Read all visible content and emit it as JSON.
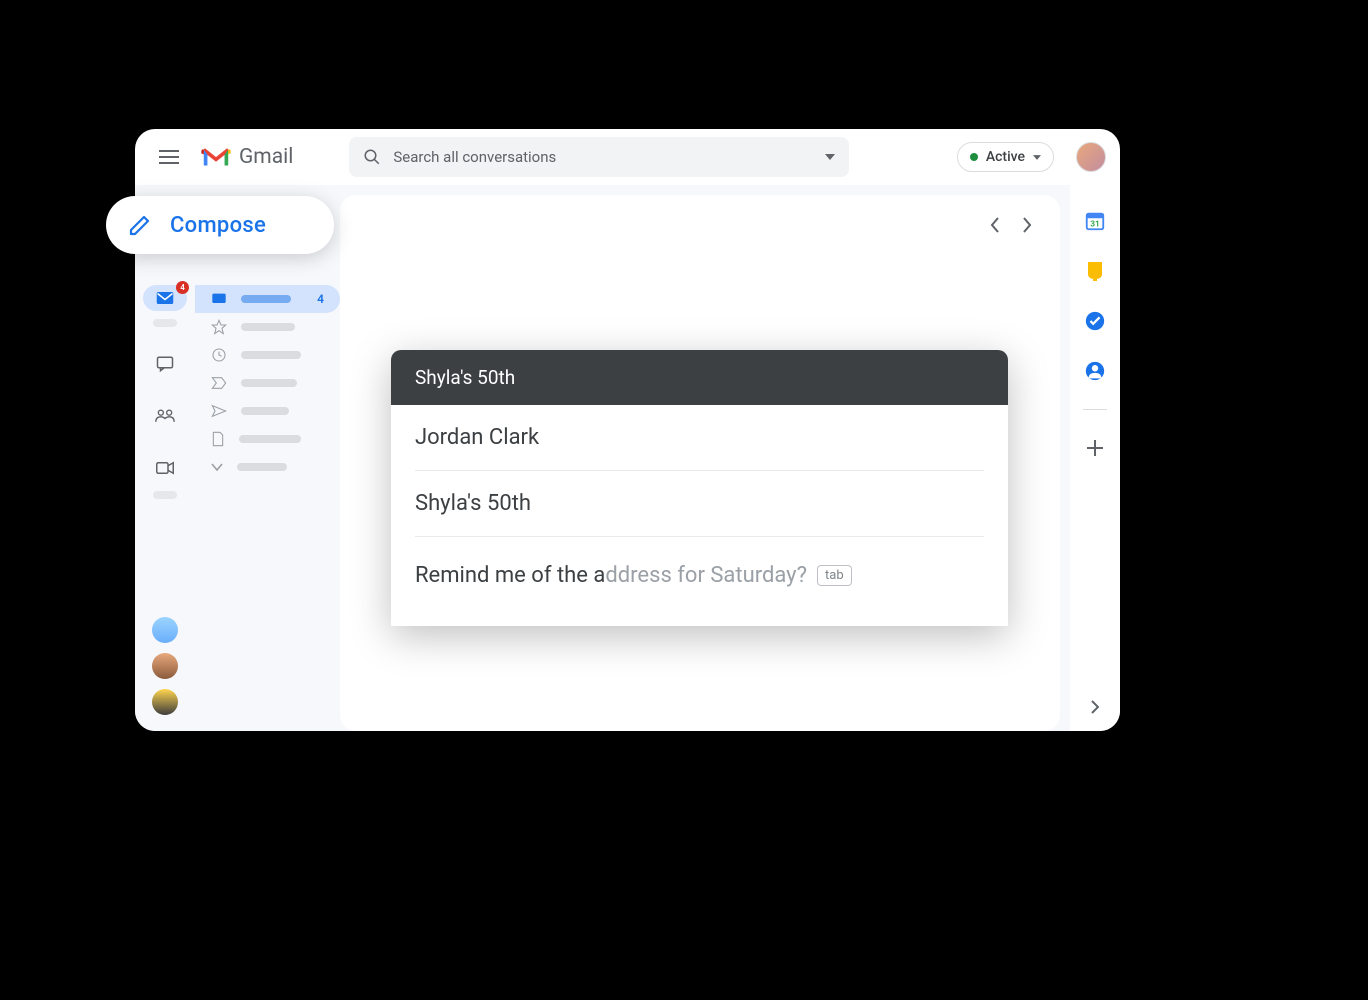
{
  "brand": {
    "name": "Gmail"
  },
  "search": {
    "placeholder": "Search all conversations"
  },
  "status": {
    "label": "Active"
  },
  "nav": {
    "inbox_count": "4"
  },
  "rail": {
    "mail_badge": "4"
  },
  "compose_button": {
    "label": "Compose"
  },
  "compose": {
    "title": "Shyla's 50th",
    "to": "Jordan Clark",
    "subject": "Shyla's 50th",
    "typed": "Remind me of the a",
    "suggested": "ddress for Saturday?",
    "hint": "tab"
  }
}
